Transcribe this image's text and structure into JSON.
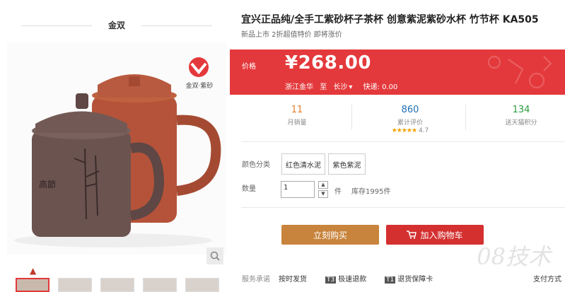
{
  "store": {
    "name": "金双",
    "logo_caption": "金双·紫砂"
  },
  "product": {
    "title": "宜兴正品纯/全手工紫砂杯子茶杯 创意紫泥紫砂水杯 竹节杯 KA505",
    "subtitle": "新品上市 2折超值特价 即将涨价"
  },
  "price": {
    "label": "价格",
    "value": "¥268.00"
  },
  "shipping": {
    "from": "浙江金华",
    "to_label": "至",
    "to": "长沙",
    "chevron": "▾",
    "express": "快递: 0.00"
  },
  "stats": {
    "monthly_sales": {
      "value": "11",
      "label": "月销量"
    },
    "reviews": {
      "value": "860",
      "label": "累计评价",
      "stars": "★★★★★",
      "rating": "4.7"
    },
    "points": {
      "value": "134",
      "label": "送天猫积分"
    }
  },
  "options": {
    "color_label": "颜色分类",
    "colors": [
      "红色清水泥",
      "紫色紫泥"
    ]
  },
  "quantity": {
    "label": "数量",
    "value": "1",
    "unit": "件",
    "stock": "库存1995件"
  },
  "actions": {
    "buy": "立刻购买",
    "cart": "加入购物车"
  },
  "service": {
    "label": "服务承诺",
    "items": [
      {
        "badge": "",
        "text": "按时发货"
      },
      {
        "badge": "T3",
        "text": "极速退款"
      },
      {
        "badge": "T1",
        "text": "退货保障卡"
      },
      {
        "badge": "",
        "text": "支付方式"
      }
    ]
  },
  "watermark": "08技术",
  "colors": {
    "accent": "#e4393c",
    "buy_button": "#c8843c",
    "cart_button": "#d43030",
    "sales": "#e57e2a",
    "reviews": "#1f6fb5",
    "points": "#2a9d3d"
  }
}
